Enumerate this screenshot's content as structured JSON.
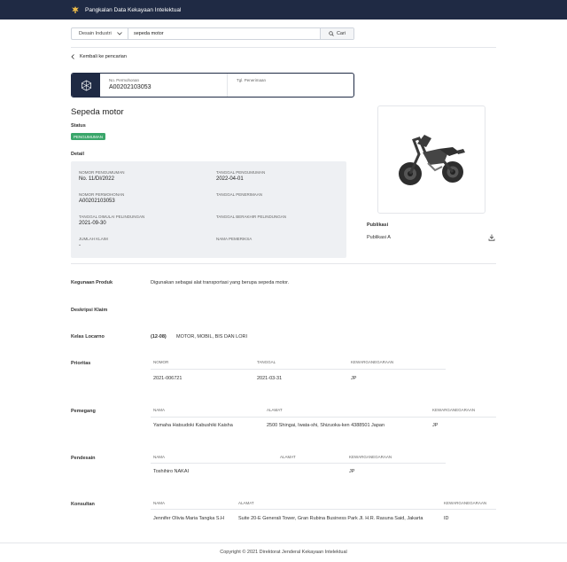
{
  "header": {
    "title": "Pangkalan Data Kekayaan Intelektual"
  },
  "search": {
    "category": "Desain Industri",
    "query": "sepeda motor",
    "button_label": "Cari"
  },
  "back_label": "Kembali ke pencarian",
  "id_card": {
    "application_no_label": "No. Permohonan",
    "application_no": "A00202103053",
    "receipt_date_label": "Tgl. Penerimaan",
    "receipt_date": ""
  },
  "title": "Sepeda motor",
  "status": {
    "label": "Status",
    "value": "PENGUMUMAN",
    "color": "#3aa66a"
  },
  "detail": {
    "label": "Detail",
    "fields": [
      {
        "key": "NOMOR PENGUMUMAN",
        "value": "No. 11/DI/2022"
      },
      {
        "key": "TANGGAL PENGUMUMAN",
        "value": "2022-04-01"
      },
      {
        "key": "NOMOR PERMOHONAN",
        "value": "A00202103053"
      },
      {
        "key": "TANGGAL PENERIMAAN",
        "value": ""
      },
      {
        "key": "TANGGAL DIMULAI PELINDUNGAN",
        "value": "2021-09-30"
      },
      {
        "key": "TANGGAL BERAKHIR PELINDUNGAN",
        "value": ""
      },
      {
        "key": "JUMLAH KLAIM",
        "value": "-"
      },
      {
        "key": "NAMA PEMERIKSA",
        "value": ""
      }
    ]
  },
  "publication": {
    "label": "Publikasi",
    "item": "Publikasi A"
  },
  "product_use": {
    "label": "Kegunaan Produk",
    "value": "Digunakan sebagai alat transportasi yang berupa sepeda motor."
  },
  "claim_description": {
    "label": "Deskripsi Klaim",
    "value": ""
  },
  "locarno": {
    "label": "Kelas Locarno",
    "code": "(12-08)",
    "value": "MOTOR, MOBIL, BIS DAN LORI"
  },
  "priority": {
    "label": "Prioritas",
    "headers": [
      "NOMOR",
      "TANGGAL",
      "KEWARGANEGARAAN"
    ],
    "row": [
      "2021-006721",
      "2021-03-31",
      "JP"
    ]
  },
  "holder": {
    "label": "Pemegang",
    "headers": [
      "NAMA",
      "ALAMAT",
      "KEWARGANEGARAAN"
    ],
    "row": [
      "Yamaha Hatsudoki Kabushiki Kaisha",
      "2500 Shingai, Iwata-shi, Shizuoka-ken 4388501 Japan",
      "JP"
    ]
  },
  "designer": {
    "label": "Pendesain",
    "headers": [
      "NAMA",
      "ALAMAT",
      "KEWARGANEGARAAN"
    ],
    "row": [
      "Toshihiro NAKAI",
      "",
      "JP"
    ]
  },
  "consultant": {
    "label": "Konsultan",
    "headers": [
      "NAMA",
      "ALAMAT",
      "KEWARGANEGARAAN"
    ],
    "row": [
      "Jennifer Olivia Maria Tangka S.H",
      "Suite 20-E Generali Tower, Gran Rubina Business Park Jl. H.R. Rasuna Said, Jakarta",
      "ID"
    ]
  },
  "footer": {
    "copyright": "Copyright © 2021 Direktorat Jenderal Kekayaan Intelektual"
  },
  "icons": {
    "logo": "garuda-emblem-icon",
    "dropdown": "chevron-down-icon",
    "search": "search-icon",
    "back": "chevron-left-icon",
    "id_card": "design-cube-icon",
    "download": "download-icon"
  },
  "colors": {
    "navy": "#1f2a44",
    "status_green": "#3aa66a",
    "detail_bg": "#eef0f3"
  }
}
